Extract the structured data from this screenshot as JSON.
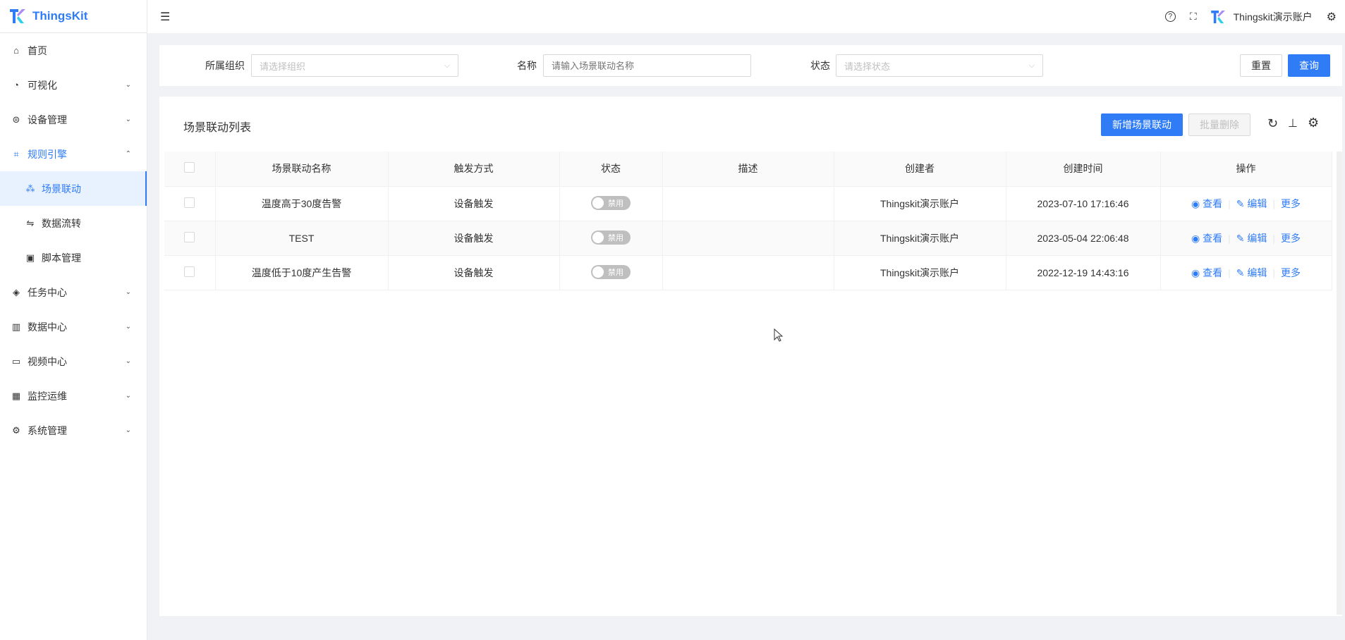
{
  "app": {
    "name": "ThingsKit"
  },
  "sidebar": {
    "items": [
      {
        "label": "首页",
        "icon": "home-icon",
        "chev": ""
      },
      {
        "label": "可视化",
        "icon": "dashboard-icon",
        "chev": "⌄"
      },
      {
        "label": "设备管理",
        "icon": "device-icon",
        "chev": "⌄"
      },
      {
        "label": "规则引擎",
        "icon": "rule-icon",
        "chev": "⌃"
      },
      {
        "label": "场景联动",
        "icon": "scene-icon",
        "chev": ""
      },
      {
        "label": "数据流转",
        "icon": "flow-icon",
        "chev": ""
      },
      {
        "label": "脚本管理",
        "icon": "script-icon",
        "chev": ""
      },
      {
        "label": "任务中心",
        "icon": "task-icon",
        "chev": "⌄"
      },
      {
        "label": "数据中心",
        "icon": "chart-icon",
        "chev": "⌄"
      },
      {
        "label": "视频中心",
        "icon": "video-icon",
        "chev": "⌄"
      },
      {
        "label": "监控运维",
        "icon": "monitor-icon",
        "chev": "⌄"
      },
      {
        "label": "系统管理",
        "icon": "gear-icon",
        "chev": "⌄"
      }
    ]
  },
  "header": {
    "account": "Thingskit演示账户"
  },
  "filter": {
    "org_label": "所属组织",
    "org_placeholder": "请选择组织",
    "name_label": "名称",
    "name_placeholder": "请输入场景联动名称",
    "status_label": "状态",
    "status_placeholder": "请选择状态",
    "reset": "重置",
    "query": "查询"
  },
  "table": {
    "title": "场景联动列表",
    "add": "新增场景联动",
    "batch_delete": "批量删除",
    "columns": [
      "场景联动名称",
      "触发方式",
      "状态",
      "描述",
      "创建者",
      "创建时间",
      "操作"
    ],
    "rows": [
      {
        "name": "温度高于30度告警",
        "trigger": "设备触发",
        "status": "禁用",
        "desc": "",
        "creator": "Thingskit演示账户",
        "time": "2023-07-10 17:16:46"
      },
      {
        "name": "TEST",
        "trigger": "设备触发",
        "status": "禁用",
        "desc": "",
        "creator": "Thingskit演示账户",
        "time": "2023-05-04 22:06:48"
      },
      {
        "name": "温度低于10度产生告警",
        "trigger": "设备触发",
        "status": "禁用",
        "desc": "",
        "creator": "Thingskit演示账户",
        "time": "2022-12-19 14:43:16"
      }
    ],
    "actions": {
      "view": "查看",
      "edit": "编辑",
      "more": "更多"
    }
  },
  "colors": {
    "accent": "#2f7cf6"
  }
}
